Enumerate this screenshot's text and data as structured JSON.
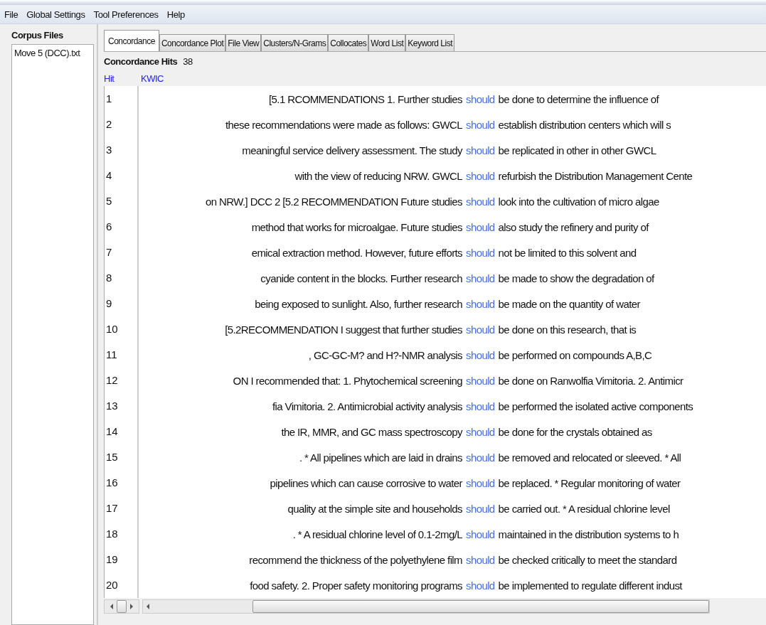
{
  "menu": [
    "File",
    "Global Settings",
    "Tool Preferences",
    "Help"
  ],
  "corpus_files": {
    "title": "Corpus Files",
    "items": [
      "Move 5 (DCC).txt"
    ]
  },
  "tabs": [
    {
      "label": "Concordance",
      "selected": true
    },
    {
      "label": "Concordance Plot",
      "selected": false
    },
    {
      "label": "File View",
      "selected": false
    },
    {
      "label": "Clusters/N-Grams",
      "selected": false
    },
    {
      "label": "Collocates",
      "selected": false
    },
    {
      "label": "Word List",
      "selected": false
    },
    {
      "label": "Keyword List",
      "selected": false
    }
  ],
  "hits": {
    "label": "Concordance Hits",
    "count": "38"
  },
  "columns": [
    "Hit",
    "KWIC"
  ],
  "rows": [
    {
      "hit": "1",
      "left": "[5.1 RCOMMENDATIONS 1. Further studies",
      "keyword": "should",
      "right": "be done to determine the influence of"
    },
    {
      "hit": "2",
      "left": "these recommendations were made as follows: GWCL",
      "keyword": "should",
      "right": "establish distribution centers which will s"
    },
    {
      "hit": "3",
      "left": "meaningful service delivery assessment. The study",
      "keyword": "should",
      "right": "be replicated in other in other GWCL"
    },
    {
      "hit": "4",
      "left": "with the view of reducing NRW. GWCL",
      "keyword": "should",
      "right": "refurbish the Distribution Management Cente"
    },
    {
      "hit": "5",
      "left": "on NRW.] DCC 2 [5.2 RECOMMENDATION Future studies",
      "keyword": "should",
      "right": "look into the cultivation of micro algae"
    },
    {
      "hit": "6",
      "left": "method that works for microalgae. Future studies",
      "keyword": "should",
      "right": "also study the refinery and purity of"
    },
    {
      "hit": "7",
      "left": "emical extraction method. However, future efforts",
      "keyword": "should",
      "right": "not be limited to this solvent and"
    },
    {
      "hit": "8",
      "left": "cyanide content in the blocks. Further research",
      "keyword": "should",
      "right": "be made to show the degradation of"
    },
    {
      "hit": "9",
      "left": "being exposed to sunlight. Also, further research",
      "keyword": "should",
      "right": "be made on the quantity of water"
    },
    {
      "hit": "10",
      "left": "[5.2RECOMMENDATION I suggest that further studies",
      "keyword": "should",
      "right": "be done on this research, that is"
    },
    {
      "hit": "11",
      "left": ", GC-GC-M? and H?-NMR analysis",
      "keyword": "should",
      "right": "be performed on compounds A,B,C"
    },
    {
      "hit": "12",
      "left": "ON I recommended that: 1. Phytochemical screening",
      "keyword": "should",
      "right": "be done on Ranwolfia Vimitoria. 2. Antimicr"
    },
    {
      "hit": "13",
      "left": "fia Vimitoria. 2. Antimicrobial activity analysis",
      "keyword": "should",
      "right": "be performed the isolated active components"
    },
    {
      "hit": "14",
      "left": "the IR, MMR, and GC mass spectroscopy",
      "keyword": "should",
      "right": "be done for the crystals obtained as"
    },
    {
      "hit": "15",
      "left": ". * All pipelines which are laid in drains",
      "keyword": "should",
      "right": "be removed and relocated or sleeved. * All"
    },
    {
      "hit": "16",
      "left": "pipelines which can cause corrosive to water",
      "keyword": "should",
      "right": "be replaced. * Regular monitoring of water"
    },
    {
      "hit": "17",
      "left": "quality at the simple site and households",
      "keyword": "should",
      "right": "be carried out. * A residual chlorine level"
    },
    {
      "hit": "18",
      "left": ". * A residual chlorine level of 0.1-2mg/L",
      "keyword": "should",
      "right": "maintained in the distribution systems to h"
    },
    {
      "hit": "19",
      "left": "recommend the thickness of the polyethylene film",
      "keyword": "should",
      "right": "be checked critically to meet the standard"
    },
    {
      "hit": "20",
      "left": "food safety. 2. Proper safety monitoring programs",
      "keyword": "should",
      "right": "be implemented to regulate different indust"
    }
  ]
}
